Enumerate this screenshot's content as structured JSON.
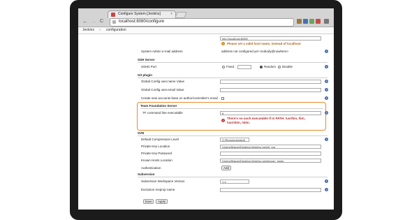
{
  "browser": {
    "tab_title": "Configure System [Jenkins]",
    "tab_close": "×",
    "url": "localhost:8080/configure",
    "back": "←",
    "forward": "→",
    "reload": "C"
  },
  "breadcrumb": {
    "root": "Jenkins",
    "separator": "»",
    "current": "configuration"
  },
  "top": {
    "url_value": "http://localhost:8080/",
    "url_warning": "Please set a valid host name, instead of localhost",
    "admin_email_label": "System Admin e-mail address",
    "admin_email_value": "address not configured yet <nobody@nowhere>"
  },
  "ssh": {
    "title": "SSH Server",
    "port_label": "SSHD Port",
    "fixed_label": "Fixed :",
    "random_label": "Random",
    "disable_label": "Disable",
    "selected": "Random"
  },
  "git": {
    "title": "Git plugin",
    "username_label": "Global Config user.name Value",
    "email_label": "Global Config user.email Value",
    "create_accounts_label": "Create new accounts base on author/committer's email"
  },
  "tfs": {
    "title": "Team Foundation Server",
    "tf_label": "TF command line executable",
    "tf_value": "tf",
    "error_line1": "There's no such executable tf in PATH: /usr/bin, /bin,",
    "error_line2": "/usr/sbin, /sbin."
  },
  "svn": {
    "title": "SVN",
    "compression_label": "Default Compression Level",
    "compression_value": "3 (Recommended)",
    "pk_location_label": "Private Key Location",
    "pk_location_value": "/Users/lfbaran/Desktop/Jenkins/.ssh/id_rsa",
    "pk_password_label": "Private Key Password",
    "known_hosts_label": "Known Hosts Location",
    "known_hosts_value": "/Users/lfbaran/Desktop/Jenkins/.ssh/known_hosts",
    "auth_label": "Authentication",
    "auth_button": "Add"
  },
  "subversion": {
    "title": "Subversion",
    "workspace_label": "Subversion Workspace Version",
    "workspace_value": "1.4",
    "exclusion_label": "Exclusion revprop name"
  },
  "buttons": {
    "save": "Save",
    "apply": "Apply"
  },
  "help_glyph": "?",
  "error_glyph": "!",
  "colors": {
    "highlight": "#e88b2c",
    "error": "#b02a2a",
    "help": "#3b64a9"
  }
}
